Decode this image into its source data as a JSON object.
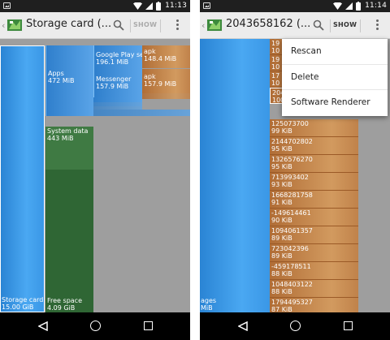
{
  "screen1": {
    "status": {
      "time": "11:13"
    },
    "actionbar": {
      "title": "Storage card (...",
      "show_label": "SHOW"
    },
    "tiles": [
      {
        "label": "Storage card",
        "size": "15.00 GiB"
      },
      {
        "label": "Apps",
        "size": "472 MiB"
      },
      {
        "label": "Google Play se",
        "size": "196.1 MiB"
      },
      {
        "label": "apk",
        "size": "148.4 MiB"
      },
      {
        "label": "Messenger",
        "size": "157.9 MiB"
      },
      {
        "label": "apk",
        "size": "157.9 MiB"
      },
      {
        "label": "System data",
        "size": "443 MiB"
      },
      {
        "label": "Free space",
        "size": "4.09 GiB"
      }
    ]
  },
  "screen2": {
    "status": {
      "time": "11:14"
    },
    "actionbar": {
      "title": "2043658162 (...",
      "show_label": "SHOW"
    },
    "menu": {
      "items": [
        "Rescan",
        "Delete",
        "Software Renderer"
      ]
    },
    "left_label": {
      "line1": "ages",
      "line2": "MiB"
    },
    "files": [
      {
        "name": "19",
        "size": "10"
      },
      {
        "name": "19",
        "size": "10"
      },
      {
        "name": "17",
        "size": "10"
      },
      {
        "name": "204",
        "size": "100"
      },
      {
        "name": "125073700",
        "size": "99 KiB"
      },
      {
        "name": "2144702802",
        "size": "95 KiB"
      },
      {
        "name": "1326576270",
        "size": "95 KiB"
      },
      {
        "name": "713993402",
        "size": "93 KiB"
      },
      {
        "name": "1668281758",
        "size": "91 KiB"
      },
      {
        "name": "-149614461",
        "size": "90 KiB"
      },
      {
        "name": "1094061357",
        "size": "89 KiB"
      },
      {
        "name": "723042396",
        "size": "89 KiB"
      },
      {
        "name": "-459178511",
        "size": "88 KiB"
      },
      {
        "name": "1048403122",
        "size": "88 KiB"
      },
      {
        "name": "1794495327",
        "size": "87 KiB"
      }
    ]
  },
  "icons": {
    "app": "treemap-app-icon",
    "search": "search-icon",
    "overflow": "overflow-menu-icon",
    "back": "back-triangle-icon",
    "home": "home-circle-icon",
    "recents": "recents-square-icon"
  }
}
